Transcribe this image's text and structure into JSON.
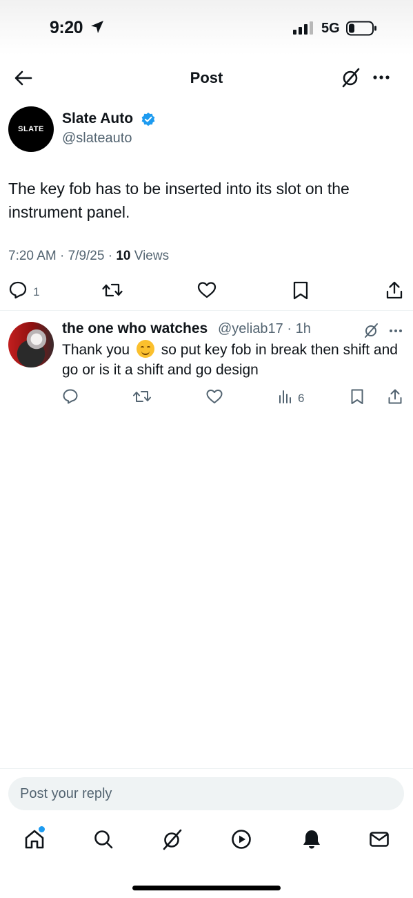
{
  "status_bar": {
    "time": "9:20",
    "network": "5G",
    "icons": [
      "location-arrow-icon",
      "signal-bars-icon",
      "battery-icon"
    ]
  },
  "nav": {
    "title": "Post",
    "icons": [
      "back-arrow-icon",
      "grok-icon",
      "more-dots-icon"
    ]
  },
  "post": {
    "author_name": "Slate Auto",
    "author_handle": "@slateauto",
    "avatar_text": "SLATE",
    "verified": true,
    "text": "The key fob has to be inserted into its slot on the instrument panel.",
    "time": "7:20 AM",
    "date": "7/9/25",
    "views_count": "10",
    "views_label": "Views",
    "reply_count": "1",
    "action_icons": [
      "reply-icon",
      "repost-icon",
      "like-icon",
      "bookmark-icon",
      "share-icon"
    ]
  },
  "reply": {
    "author_name": "the one who watches",
    "author_handle": "@yeliab17",
    "age": "1h",
    "text_before_emoji": "Thank you",
    "emoji": "smiling-face-emoji",
    "text_after_emoji": "so put key fob in break then shift and go or is it a shift and go design",
    "views_count": "6",
    "action_icons": [
      "reply-icon",
      "repost-icon",
      "like-icon",
      "views-icon",
      "bookmark-icon",
      "share-icon"
    ]
  },
  "composer": {
    "placeholder": "Post your reply"
  },
  "tab_bar": {
    "tabs": [
      "home-tab",
      "search-tab",
      "grok-tab",
      "video-tab",
      "notifications-tab",
      "messages-tab"
    ],
    "home_badge": true
  },
  "colors": {
    "text": "#0f1419",
    "secondary": "#536471",
    "verified": "#1d9bf0",
    "divider": "#eff3f4",
    "input_bg": "#eff3f4"
  }
}
